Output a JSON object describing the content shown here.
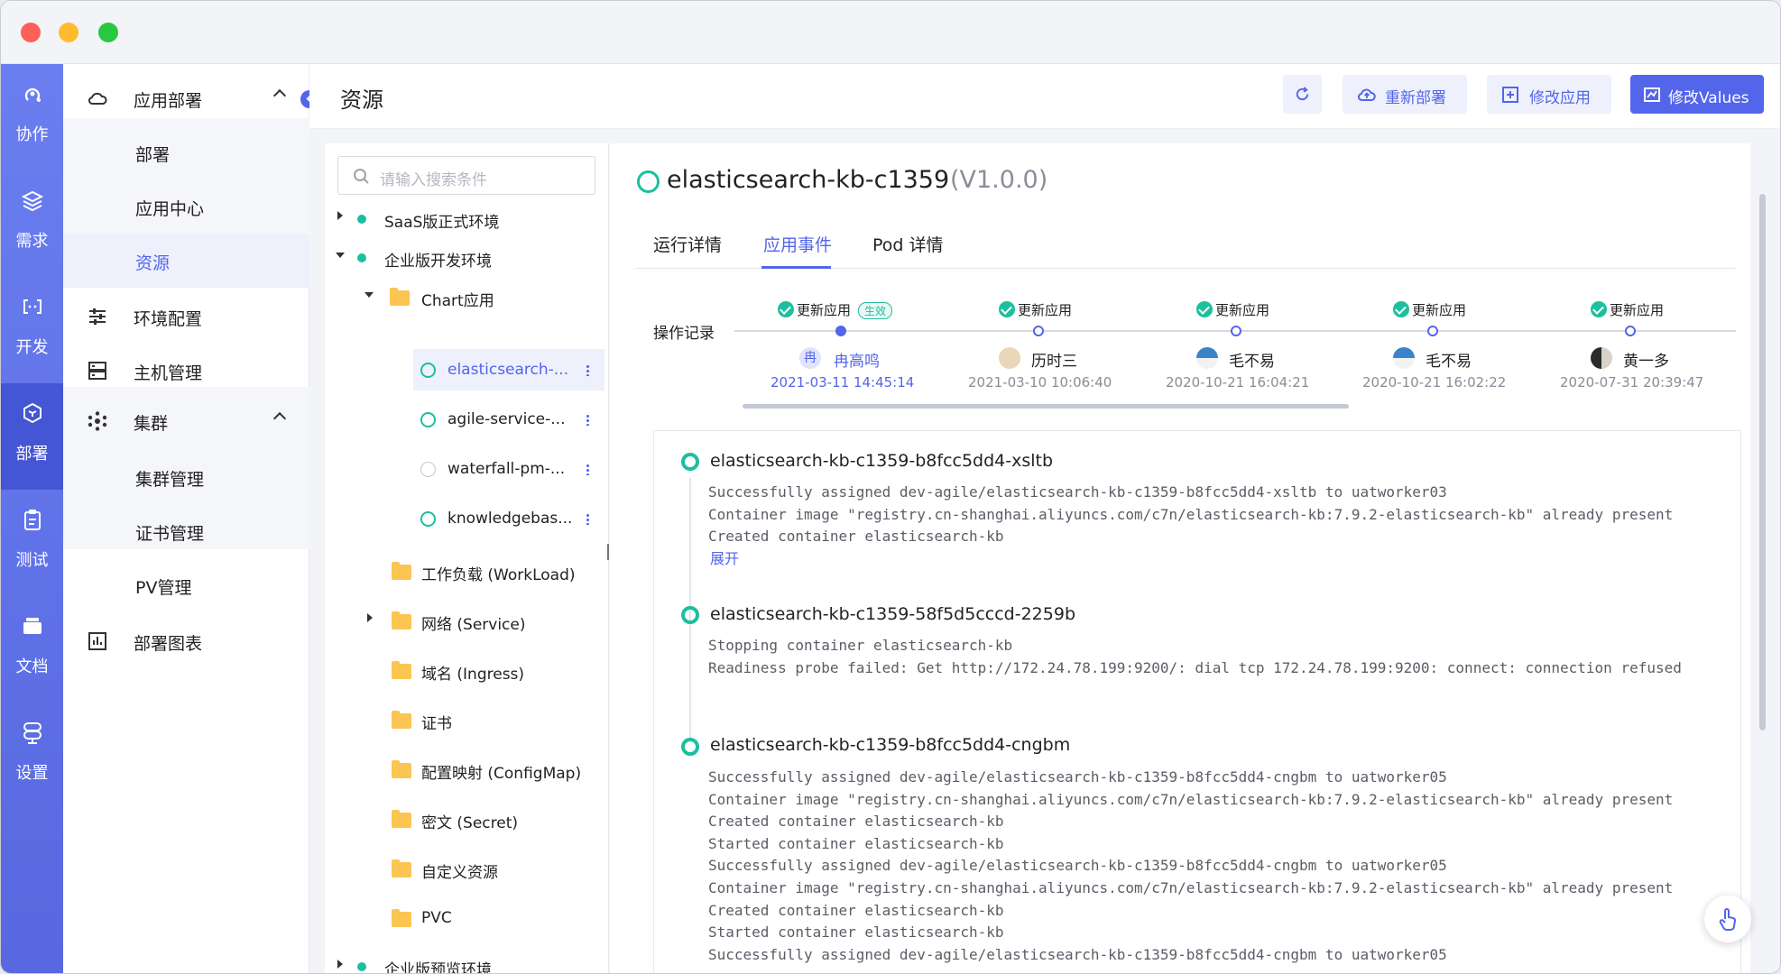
{
  "rail": [
    {
      "label": "协作",
      "icon": "collaboration-icon"
    },
    {
      "label": "需求",
      "icon": "layers-icon"
    },
    {
      "label": "开发",
      "icon": "code-icon"
    },
    {
      "label": "部署",
      "icon": "deploy-icon"
    },
    {
      "label": "测试",
      "icon": "clipboard-icon"
    },
    {
      "label": "文档",
      "icon": "folder-icon"
    },
    {
      "label": "设置",
      "icon": "settings-icon"
    }
  ],
  "sidebar": {
    "app_deploy": "应用部署",
    "deploy": "部署",
    "app_center": "应用中心",
    "resource": "资源",
    "env_config": "环境配置",
    "host_mgmt": "主机管理",
    "cluster": "集群",
    "cluster_mgmt": "集群管理",
    "cert_mgmt": "证书管理",
    "pv_mgmt": "PV管理",
    "deploy_charts": "部署图表"
  },
  "header": {
    "title": "资源",
    "redeploy": "重新部署",
    "modify_app": "修改应用",
    "modify_values": "修改Values"
  },
  "tree": {
    "search_placeholder": "请输入搜索条件",
    "nodes": {
      "saas": "SaaS版正式环境",
      "enterprise_dev": "企业版开发环境",
      "chart_app": "Chart应用",
      "app1": "elasticsearch-...",
      "app2": "agile-service-...",
      "app3": "waterfall-pm-...",
      "app4": "knowledgebas...",
      "workload": "工作负载 (WorkLoad)",
      "service": "网络 (Service)",
      "ingress": "域名 (Ingress)",
      "cert": "证书",
      "configmap": "配置映射 (ConfigMap)",
      "secret": "密文 (Secret)",
      "custom": "自定义资源",
      "pvc": "PVC",
      "enterprise_preview": "企业版预览环境"
    }
  },
  "detail": {
    "app_name": "elasticsearch-kb-c1359",
    "version": "(V1.0.0)",
    "tabs": [
      "运行详情",
      "应用事件",
      "Pod 详情"
    ],
    "timeline_label": "操作记录",
    "timeline": [
      {
        "action": "更新应用",
        "badge": "生效",
        "user": "冉高鸣",
        "time": "2021-03-11 14:45:14"
      },
      {
        "action": "更新应用",
        "user": "历时三",
        "time": "2021-03-10 10:06:40"
      },
      {
        "action": "更新应用",
        "user": "毛不易",
        "time": "2020-10-21 16:04:21"
      },
      {
        "action": "更新应用",
        "user": "毛不易",
        "time": "2020-10-21 16:02:22"
      },
      {
        "action": "更新应用",
        "user": "黄一多",
        "time": "2020-07-31 20:39:47"
      }
    ],
    "avatar_char": "冉",
    "events": [
      {
        "title": "elasticsearch-kb-c1359-b8fcc5dd4-xsltb",
        "log": "Successfully assigned dev-agile/elasticsearch-kb-c1359-b8fcc5dd4-xsltb to uatworker03\nContainer image \"registry.cn-shanghai.aliyuncs.com/c7n/elasticsearch-kb:7.9.2-elasticsearch-kb\" already present \nCreated container elasticsearch-kb",
        "expand": "展开"
      },
      {
        "title": "elasticsearch-kb-c1359-58f5d5cccd-2259b",
        "log": "Stopping container elasticsearch-kb\nReadiness probe failed: Get http://172.24.78.199:9200/: dial tcp 172.24.78.199:9200: connect: connection refused"
      },
      {
        "title": "elasticsearch-kb-c1359-b8fcc5dd4-cngbm",
        "log": "Successfully assigned dev-agile/elasticsearch-kb-c1359-b8fcc5dd4-cngbm to uatworker05\nContainer image \"registry.cn-shanghai.aliyuncs.com/c7n/elasticsearch-kb:7.9.2-elasticsearch-kb\" already present \nCreated container elasticsearch-kb\nStarted container elasticsearch-kb\nSuccessfully assigned dev-agile/elasticsearch-kb-c1359-b8fcc5dd4-cngbm to uatworker05\nContainer image \"registry.cn-shanghai.aliyuncs.com/c7n/elasticsearch-kb:7.9.2-elasticsearch-kb\" already present \nCreated container elasticsearch-kb\nStarted container elasticsearch-kb\nSuccessfully assigned dev-agile/elasticsearch-kb-c1359-b8fcc5dd4-cngbm to uatworker05"
      }
    ]
  },
  "colors": {
    "primary": "#5365ea",
    "success": "#1dbf9e",
    "rail": "#5868e0"
  }
}
